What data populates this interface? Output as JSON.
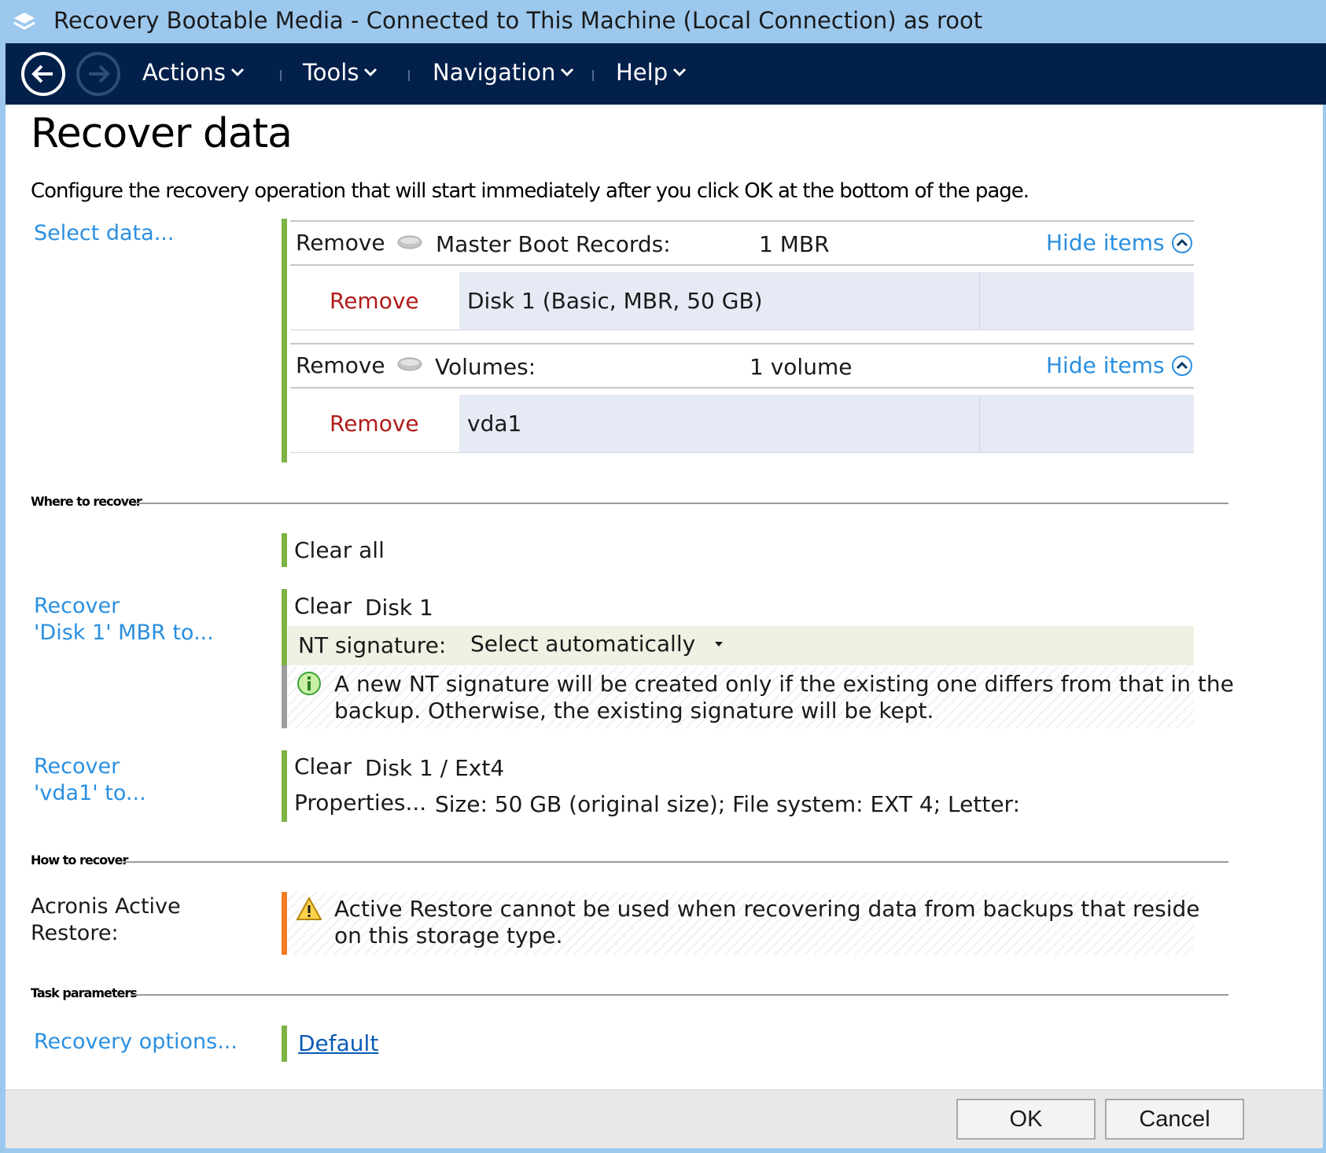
{
  "window": {
    "title": "Recovery Bootable Media - Connected to This Machine (Local Connection) as root",
    "icon": "acronis-layers-icon"
  },
  "menubar": {
    "back_icon": "back-arrow-icon",
    "forward_icon": "forward-arrow-icon",
    "items": [
      {
        "label": "Actions"
      },
      {
        "label": "Tools"
      },
      {
        "label": "Navigation"
      },
      {
        "label": "Help"
      }
    ]
  },
  "page": {
    "title": "Recover data",
    "description": "Configure the recovery operation that will start immediately after you click OK at the bottom of the page."
  },
  "select_data": {
    "link": "Select data...",
    "groups": [
      {
        "remove": "Remove",
        "name": "Master Boot Records:",
        "count": "1 MBR",
        "hide": "Hide items",
        "items": [
          {
            "remove": "Remove",
            "value": "Disk 1 (Basic, MBR, 50 GB)"
          }
        ]
      },
      {
        "remove": "Remove",
        "name": "Volumes:",
        "count": "1 volume",
        "hide": "Hide items",
        "items": [
          {
            "remove": "Remove",
            "value": "vda1"
          }
        ]
      }
    ]
  },
  "where_to_recover": {
    "heading": "Where to recover",
    "clear_all": "Clear all",
    "mbr": {
      "label_line1": "Recover",
      "label_line2": "'Disk 1' MBR to...",
      "clear": "Clear",
      "target": "Disk 1",
      "nt_label": "NT signature:",
      "nt_value": "Select automatically",
      "info_line1": "A new NT signature will be created only if the existing one differs from that in the",
      "info_line2": "backup. Otherwise, the existing signature will be kept."
    },
    "volume": {
      "label_line1": "Recover",
      "label_line2": "'vda1' to...",
      "clear": "Clear",
      "target": "Disk 1 / Ext4",
      "properties": "Properties...",
      "details": "Size: 50 GB (original size); File system: EXT 4; Letter:"
    }
  },
  "how_to_recover": {
    "heading": "How to recover",
    "label_line1": "Acronis Active",
    "label_line2": "Restore:",
    "warning_line1": "Active Restore cannot be used when recovering data from backups that reside",
    "warning_line2": "on this storage type."
  },
  "task_parameters": {
    "heading": "Task parameters",
    "link": "Recovery options...",
    "value": "Default"
  },
  "footer": {
    "ok": "OK",
    "cancel": "Cancel"
  },
  "colors": {
    "titlebar": "#9dc8ee",
    "menubar": "#03204a",
    "link": "#2a8fe0",
    "remove": "#b01b1b",
    "green_bar": "#7cb342",
    "orange_bar": "#f47c20"
  }
}
